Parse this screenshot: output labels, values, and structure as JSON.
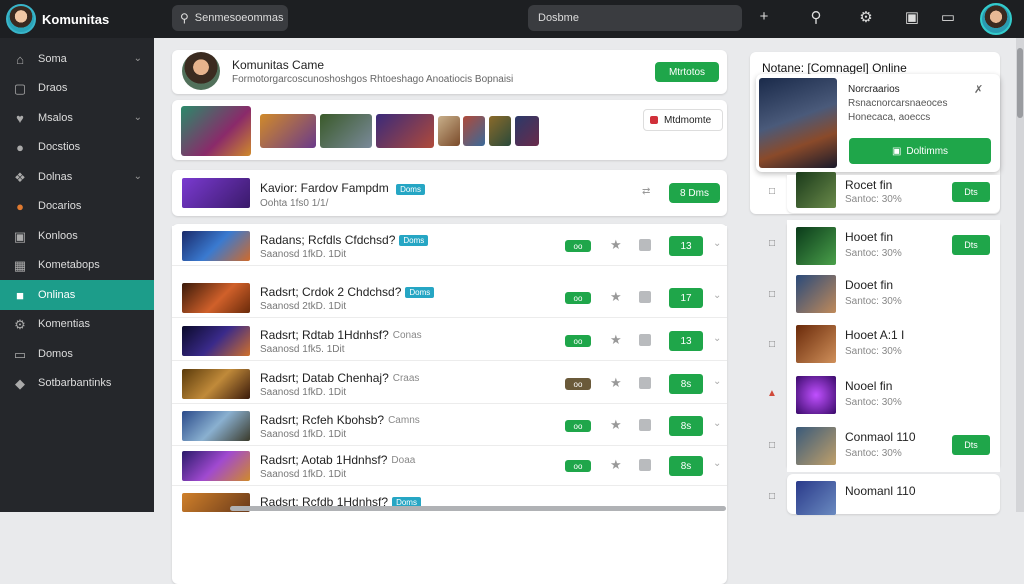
{
  "topbar": {
    "app_name": "Komunitas",
    "search_left": "Senmesoeommas",
    "search_center": "Dosbme",
    "icons": [
      "plus-icon",
      "search-icon",
      "settings-icon",
      "gamepad-icon",
      "screen-icon"
    ]
  },
  "sidebar": {
    "items": [
      {
        "label": "Soma",
        "icon": "home-icon",
        "chevron": true
      },
      {
        "label": "Draos",
        "icon": "folder-icon",
        "chevron": false
      },
      {
        "label": "Msalos",
        "icon": "heart-icon",
        "chevron": true
      },
      {
        "label": "Docstios",
        "icon": "bell-icon",
        "chevron": false
      },
      {
        "label": "Dolnas",
        "icon": "compass-icon",
        "chevron": true
      },
      {
        "label": "Docarios",
        "icon": "fire-icon",
        "chevron": false
      },
      {
        "label": "Konloos",
        "icon": "box-icon",
        "chevron": false
      },
      {
        "label": "Kometabops",
        "icon": "grid-icon",
        "chevron": false
      },
      {
        "label": "Onlinas",
        "icon": "users-icon",
        "chevron": false,
        "active": true
      },
      {
        "label": "Komentias",
        "icon": "gear-icon",
        "chevron": false
      },
      {
        "label": "Domos",
        "icon": "tv-icon",
        "chevron": false
      },
      {
        "label": "Sotbarbantinks",
        "icon": "tag-icon",
        "chevron": false
      }
    ]
  },
  "header_card": {
    "title": "Komunitas Came",
    "subtitle": "Formotorgarcoscunoshoshgos Rhtoeshago Anoatiocis Bopnaisi",
    "button": "Mtrtotos",
    "side_button": "Mtdmomte"
  },
  "game_rows": [
    {
      "title": "Kavior: Fardov Fampdm",
      "tag": "Doms",
      "sub": "Oohta 1fs0 1/1/",
      "pill": "",
      "btn": "8 Dms",
      "thumb": "#6a2fb0"
    },
    {
      "title": "Radans; Rcfdls Cfdchsd?",
      "tag": "Doms",
      "sub": "Saanosd 1fkD. 1Dit",
      "pill": "oo",
      "btn": "13",
      "thumb": "#2d57b8"
    },
    {
      "title": "Radsrt; Crdok 2 Chdchsd?",
      "tag": "Doms",
      "sub": "Saanosd 2tkD. 1Dit",
      "pill": "oo",
      "btn": "17",
      "thumb": "#a5401f"
    },
    {
      "title": "Radsrt; Rdtab 1Hdnhsf?",
      "tag": "Conas",
      "sub": "Saanosd 1fk5. 1Dit",
      "pill": "oo",
      "btn": "13",
      "thumb": "#4a2b86"
    },
    {
      "title": "Radsrt; Datab Chenhaj?",
      "tag": "Craas",
      "sub": "Saanosd 1fkD. 1Dit",
      "pill": "oo",
      "btn": "8s",
      "thumb": "#8a5a1a"
    },
    {
      "title": "Radsrt; Rcfeh Kbohsb?",
      "tag": "Camns",
      "sub": "Saanosd 1fkD. 1Dit",
      "pill": "oo",
      "btn": "8s",
      "thumb": "#3d6fa8"
    },
    {
      "title": "Radsrt; Aotab 1Hdnhsf?",
      "tag": "Doaa",
      "sub": "Saanosd 1fkD. 1Dit",
      "pill": "oo",
      "btn": "8s",
      "thumb": "#6b3fa0"
    },
    {
      "title": "Radsrt; Rcfdb 1Hdnhsf?",
      "tag": "Doms",
      "sub": "",
      "pill": "",
      "btn": "",
      "thumb": "#b86a20"
    }
  ],
  "right_panel": {
    "title": "Notane: [Comnagel] Online",
    "feature_title": "Norcraarios",
    "feature_sub1": "Rsnacnorcarsnaeoces",
    "feature_sub2": "Honecaca, aoeccs",
    "feature_button": "Doltimms",
    "rows": [
      {
        "title": "Rocet fin",
        "sub": "Santoc: 30%",
        "btn": "Dts",
        "thumb": "#3a5a2a"
      },
      {
        "title": "Hooet fin",
        "sub": "Santoc: 30%",
        "btn": "Dts",
        "thumb": "#2a6a3a"
      },
      {
        "title": "Dooet fin",
        "sub": "Santoc: 30%",
        "btn": "",
        "thumb": "#3a5a8a"
      },
      {
        "title": "Hooet A:1 I",
        "sub": "Santoc: 30%",
        "btn": "",
        "thumb": "#8a4a2a"
      },
      {
        "title": "Nooel fin",
        "sub": "Santoc: 30%",
        "btn": "",
        "thumb": "#6a1ab0"
      },
      {
        "title": "Conmaol 110",
        "sub": "Santoc: 30%",
        "btn": "Dts",
        "thumb": "#4a6a8a"
      },
      {
        "title": "Noomanl 110",
        "sub": "",
        "btn": "",
        "thumb": "#3a5a9a"
      }
    ]
  }
}
